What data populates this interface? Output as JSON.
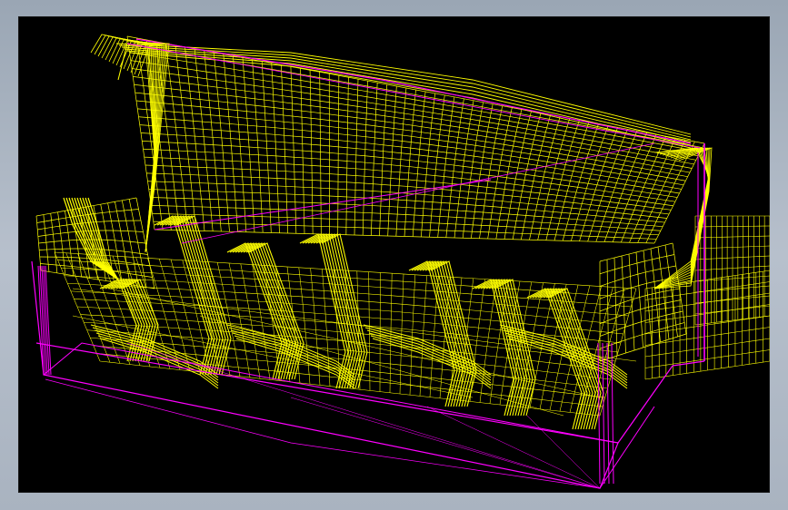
{
  "window": {
    "frame_color": "#a3aebb"
  },
  "viewport": {
    "background": "#000000",
    "model": "sofa-wireframe",
    "render_mode": "wireframe",
    "colors": {
      "surface_mesh": "#ffff00",
      "edges": "#ff00ff"
    }
  }
}
